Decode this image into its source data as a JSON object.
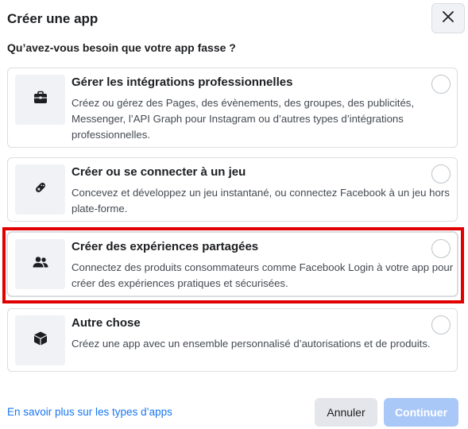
{
  "dialog": {
    "title": "Créer une app",
    "question": "Qu’avez-vous besoin que votre app fasse ?"
  },
  "icons": {
    "close": "close-icon",
    "option_1": "briefcase-icon",
    "option_2": "gamepad-icon",
    "option_3": "people-icon",
    "option_4": "cube-icon"
  },
  "options": [
    {
      "title": "Gérer les intégrations professionnelles",
      "description": "Créez ou gérez des Pages, des évènements, des groupes, des publicités, Messenger, l’API Graph pour Instagram ou d’autres types d’intégrations professionnelles.",
      "selected": false
    },
    {
      "title": "Créer ou se connecter à un jeu",
      "description": "Concevez et développez un jeu instantané, ou connectez Facebook à un jeu hors plate-forme.",
      "selected": false
    },
    {
      "title": "Créer des expériences partagées",
      "description": "Connectez des produits consommateurs comme Facebook Login à votre app pour créer des expériences pratiques et sécurisées.",
      "selected": false
    },
    {
      "title": "Autre chose",
      "description": "Créez une app avec un ensemble personnalisé d’autorisations et de produits.",
      "selected": false
    }
  ],
  "footer": {
    "learn_more": "En savoir plus sur les types d’apps",
    "cancel_label": "Annuler",
    "continue_label": "Continuer"
  },
  "colors": {
    "link": "#1877f2",
    "continue_disabled": "#a9c8f8",
    "highlight_border": "#e00000"
  }
}
